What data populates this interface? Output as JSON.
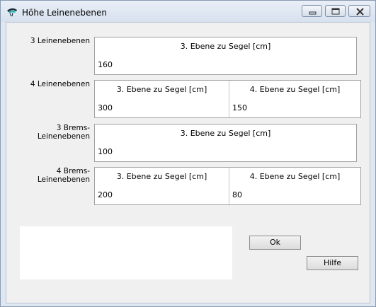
{
  "window": {
    "title": "Höhe Leinenebenen"
  },
  "rows": [
    {
      "label": "3 Leinenebenen",
      "cells": [
        {
          "header": "3. Ebene zu  Segel [cm]",
          "value": "160"
        }
      ]
    },
    {
      "label": "4 Leinenebenen",
      "cells": [
        {
          "header": "3. Ebene zu  Segel [cm]",
          "value": "300"
        },
        {
          "header": "4. Ebene zu  Segel [cm]",
          "value": "150"
        }
      ]
    },
    {
      "label": "3 Brems-Leinenebenen",
      "cells": [
        {
          "header": "3. Ebene zu  Segel [cm]",
          "value": "100"
        }
      ]
    },
    {
      "label": "4 Brems-Leinenebenen",
      "cells": [
        {
          "header": "3. Ebene zu  Segel [cm]",
          "value": "200"
        },
        {
          "header": "4. Ebene zu  Segel [cm]",
          "value": "80"
        }
      ]
    }
  ],
  "buttons": {
    "ok": "Ok",
    "help": "Hilfe"
  },
  "colors": {
    "app_icon_dark": "#1a2a3a",
    "app_icon_accent": "#2fb3a6"
  }
}
